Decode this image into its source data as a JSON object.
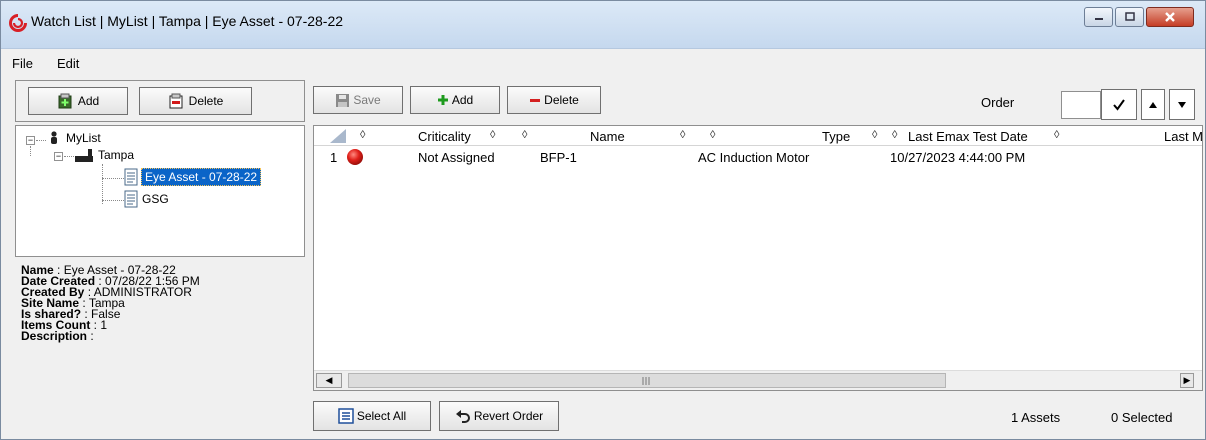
{
  "window": {
    "title": "Watch List | MyList | Tampa | Eye Asset - 07-28-22",
    "controls": [
      "minimize-icon",
      "maximize-icon",
      "close-icon"
    ]
  },
  "menu": {
    "items": [
      "File",
      "Edit"
    ]
  },
  "left_toolbar": {
    "add_label": "Add",
    "delete_label": "Delete"
  },
  "tree": {
    "root": "MyList",
    "site": "Tampa",
    "lists": [
      "Eye Asset - 07-28-22",
      "GSG"
    ],
    "selected": "Eye Asset - 07-28-22"
  },
  "details": [
    {
      "label": "Name",
      "value": " : Eye Asset - 07-28-22"
    },
    {
      "label": "Date Created",
      "value": " : 07/28/22 1:56 PM"
    },
    {
      "label": "Created By",
      "value": " : ADMINISTRATOR"
    },
    {
      "label": "Site Name",
      "value": " : Tampa"
    },
    {
      "label": "Is shared?",
      "value": " : False"
    },
    {
      "label": "Items Count",
      "value": " : 1"
    },
    {
      "label": "Description",
      "value": " :"
    }
  ],
  "right_toolbar": {
    "save_label": "Save",
    "add_label": "Add",
    "delete_label": "Delete",
    "order_label": "Order",
    "order_value": ""
  },
  "grid": {
    "columns": [
      "Criticality",
      "Name",
      "Type",
      "Last Emax Test Date",
      "Last M"
    ],
    "rows": [
      {
        "num": "1",
        "status_color": "#e0201a",
        "criticality": "Not Assigned",
        "name": "BFP-1",
        "type": "AC Induction Motor",
        "last_emax_test_date": "10/27/2023 4:44:00 PM"
      }
    ]
  },
  "bottom": {
    "select_all_label": "Select All",
    "revert_order_label": "Revert Order",
    "assets_count": "1 Assets",
    "selected_count": "0 Selected"
  },
  "colors": {
    "selection": "#0a64c8",
    "title_gradient": "#c5d8ee",
    "status_red": "#e0201a"
  }
}
